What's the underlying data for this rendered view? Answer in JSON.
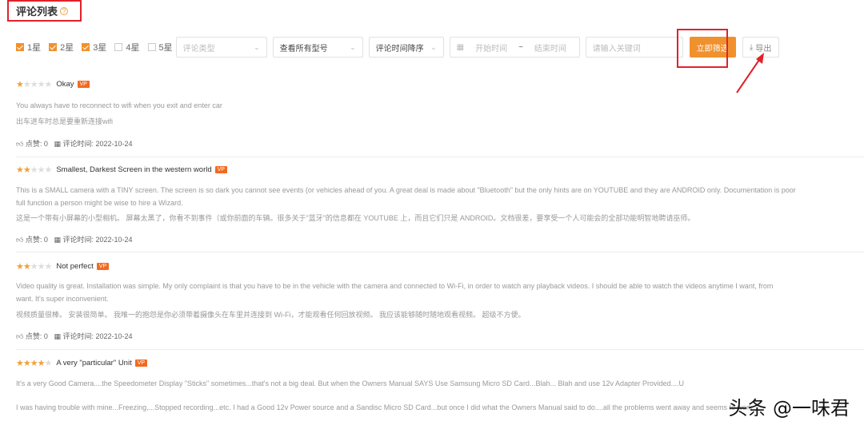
{
  "header": {
    "title": "评论列表",
    "help_icon": "?"
  },
  "filters": {
    "stars": [
      {
        "label": "1星",
        "checked": true
      },
      {
        "label": "2星",
        "checked": true
      },
      {
        "label": "3星",
        "checked": true
      },
      {
        "label": "4星",
        "checked": false
      },
      {
        "label": "5星",
        "checked": false
      }
    ],
    "review_type_placeholder": "评论类型",
    "model_select": "查看所有型号",
    "sort_select": "评论时间降序",
    "start_date_placeholder": "开始时间",
    "date_sep": "~",
    "end_date_placeholder": "结束时间",
    "keyword_placeholder": "请输入关键词",
    "filter_button": "立即筛选",
    "export_button": "导出"
  },
  "colors": {
    "accent": "#f0912e",
    "annotation": "#e0222a"
  },
  "reviews": [
    {
      "rating": 1,
      "title": "Okay",
      "badge": "VP",
      "text_en": "You always have to reconnect to wifi when you exit and enter car",
      "text_en2": "",
      "text_cn": "出车进车时总是要重新连接wifi",
      "likes": "点赞: 0",
      "time": "评论时间: 2022-10-24"
    },
    {
      "rating": 2,
      "title": "Smallest, Darkest Screen in the western world",
      "badge": "VP",
      "text_en": "This is a SMALL camera with a TINY screen. The screen is so dark you cannot see events (or vehicles ahead of you. A great deal is made about \"Bluetooth\" but the only hints are on YOUTUBE and they are ANDROID only. Documentation is poor",
      "text_en2": "full function a person might be wise to hire a Wizard.",
      "text_cn": "这是一个带有小屏幕的小型相机。 屏幕太黑了，你看不到事件（或你前面的车辆。很多关于\"蓝牙\"的信息都在 YOUTUBE 上，而且它们只是 ANDROID。文档很差，要享受一个人可能会的全部功能明智地聘请巫师。",
      "likes": "点赞: 0",
      "time": "评论时间: 2022-10-24"
    },
    {
      "rating": 2,
      "title": "Not perfect",
      "badge": "VP",
      "text_en": "Video quality is great. Installation was simple. My only complaint is that you have to be in the vehicle with the camera and connected to Wi-Fi, in order to watch any playback videos. I should be able to watch the videos anytime I want, from",
      "text_en2": "want. It's super inconvenient.",
      "text_cn": "视频质量很棒。 安装很简单。 我唯一的抱怨是你必须带着摄像头在车里并连接到 Wi-Fi，才能观看任何回放视频。 我应该能够随时随地观看视频。 超级不方便。",
      "likes": "点赞: 0",
      "time": "评论时间: 2022-10-24"
    },
    {
      "rating": 4,
      "title": "A very \"particular\" Unit",
      "badge": "VP",
      "text_en": "It's a very Good Camera....the Speedometer Display \"Sticks\" sometimes...that's not a big deal. But when the Owners Manual SAYS Use Samsung Micro SD Card...Blah... Blah and use 12v Adapter Provided....U",
      "text_en2": "I was having trouble with mine...Freezing,...Stopped recording...etc. I had a Good 12v Power source and a Sandisc Micro SD Card...but once I did what the Owners Manual said to do....all the problems went away and seems to work"
    }
  ],
  "watermark": "头条 @一味君"
}
